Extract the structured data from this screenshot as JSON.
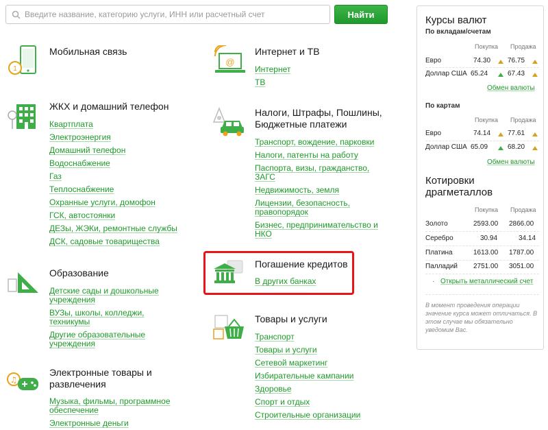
{
  "search": {
    "placeholder": "Введите название, категорию услуги, ИНН или расчетный счет",
    "button_label": "Найти"
  },
  "categories": {
    "mobile": {
      "title": "Мобильная связь",
      "links": []
    },
    "internet": {
      "title": "Интернет и ТВ",
      "links": [
        "Интернет",
        "ТВ"
      ]
    },
    "housing": {
      "title": "ЖКХ и домашний телефон",
      "links": [
        "Квартплата",
        "Электроэнергия",
        "Домашний телефон",
        "Водоснабжение",
        "Газ",
        "Теплоснабжение",
        "Охранные услуги, домофон",
        "ГСК, автостоянки",
        "ДЕЗы, ЖЭКи, ремонтные службы",
        "ДСК, садовые товарищества"
      ]
    },
    "taxes": {
      "title_line1": "Налоги, Штрафы, Пошлины,",
      "title_line2": "Бюджетные платежи",
      "links": [
        "Транспорт, вождение, парковки",
        "Налоги, патенты на работу",
        "Паспорта, визы, гражданство, ЗАГС",
        "Недвижимость, земля",
        "Лицензии, безопасность, правопорядок",
        "Бизнес, предпринимательство и НКО"
      ]
    },
    "education": {
      "title": "Образование",
      "links": [
        "Детские сады и дошкольные учреждения",
        "ВУЗы, школы, колледжи, техникумы",
        "Другие образовательные учреждения"
      ]
    },
    "loans": {
      "title": "Погашение кредитов",
      "links": [
        "В других банках"
      ]
    },
    "goods": {
      "title": "Товары и услуги",
      "links": [
        "Транспорт",
        "Товары и услуги",
        "Сетевой маркетинг",
        "Избирательные кампании",
        "Здоровье",
        "Спорт и отдых",
        "Строительные организации"
      ]
    },
    "electronic": {
      "title_line1": "Электронные товары и",
      "title_line2": "развлечения",
      "links": [
        "Музыка, фильмы, программное обеспечение",
        "Электронные деньги"
      ]
    }
  },
  "rates": {
    "title": "Курсы валют",
    "deposits": {
      "subtitle": "По вкладам/счетам",
      "buy_label": "Покупка",
      "sell_label": "Продажа",
      "rows": [
        {
          "name": "Евро",
          "buy": "74.30",
          "sell": "76.75"
        },
        {
          "name": "Доллар США",
          "buy": "65.24",
          "sell": "67.43"
        }
      ],
      "link": "Обмен валюты"
    },
    "cards": {
      "subtitle": "По картам",
      "buy_label": "Покупка",
      "sell_label": "Продажа",
      "rows": [
        {
          "name": "Евро",
          "buy": "74.14",
          "sell": "77.61"
        },
        {
          "name": "Доллар США",
          "buy": "65.09",
          "sell": "68.20"
        }
      ],
      "link": "Обмен валюты"
    }
  },
  "metals": {
    "title_line1": "Котировки",
    "title_line2": "драгметаллов",
    "buy_label": "Покупка",
    "sell_label": "Продажа",
    "rows": [
      {
        "name": "Золото",
        "buy": "2593.00",
        "sell": "2866.00"
      },
      {
        "name": "Серебро",
        "buy": "30.94",
        "sell": "34.14"
      },
      {
        "name": "Платина",
        "buy": "1613.00",
        "sell": "1787.00"
      },
      {
        "name": "Палладий",
        "buy": "2751.00",
        "sell": "3051.00"
      }
    ],
    "link": "Открыть металлический счет"
  },
  "note": "В момент проведения операции значение курса может отличаться. В этом случае мы обязательно уведомим Вас.",
  "colors": {
    "green": "#1e9b2a",
    "accent": "#3db447",
    "highlight": "#e8141a"
  }
}
